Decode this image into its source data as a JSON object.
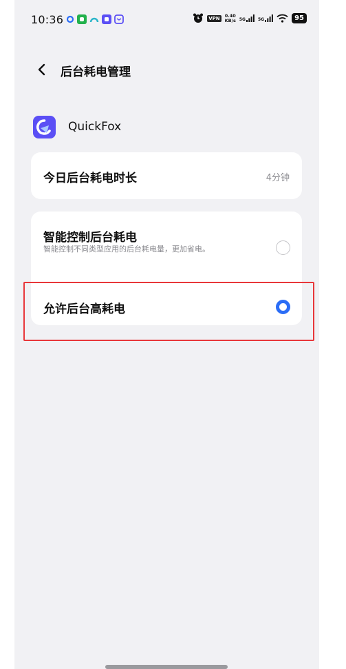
{
  "status_bar": {
    "time": "10:36",
    "vpn": "VPN",
    "net_speed_value": "0.40",
    "net_speed_unit": "KB/s",
    "signal1": "5G",
    "signal2": "5G",
    "battery": "95"
  },
  "header": {
    "title": "后台耗电管理",
    "back_icon": "chevron-left-icon"
  },
  "app": {
    "name": "QuickFox",
    "icon": "quickfox-app-icon"
  },
  "duration": {
    "label": "今日后台耗电时长",
    "value": "4分钟"
  },
  "options": {
    "smart": {
      "title": "智能控制后台耗电",
      "desc": "智能控制不同类型应用的后台耗电量，更加省电。",
      "selected": false
    },
    "allow": {
      "title": "允许后台高耗电",
      "selected": true
    }
  },
  "colors": {
    "screen_bg": "#f1f1f4",
    "card_bg": "#ffffff",
    "accent": "#2b6df6",
    "highlight": "#e8373a",
    "app_icon": "#5b4ff5"
  }
}
